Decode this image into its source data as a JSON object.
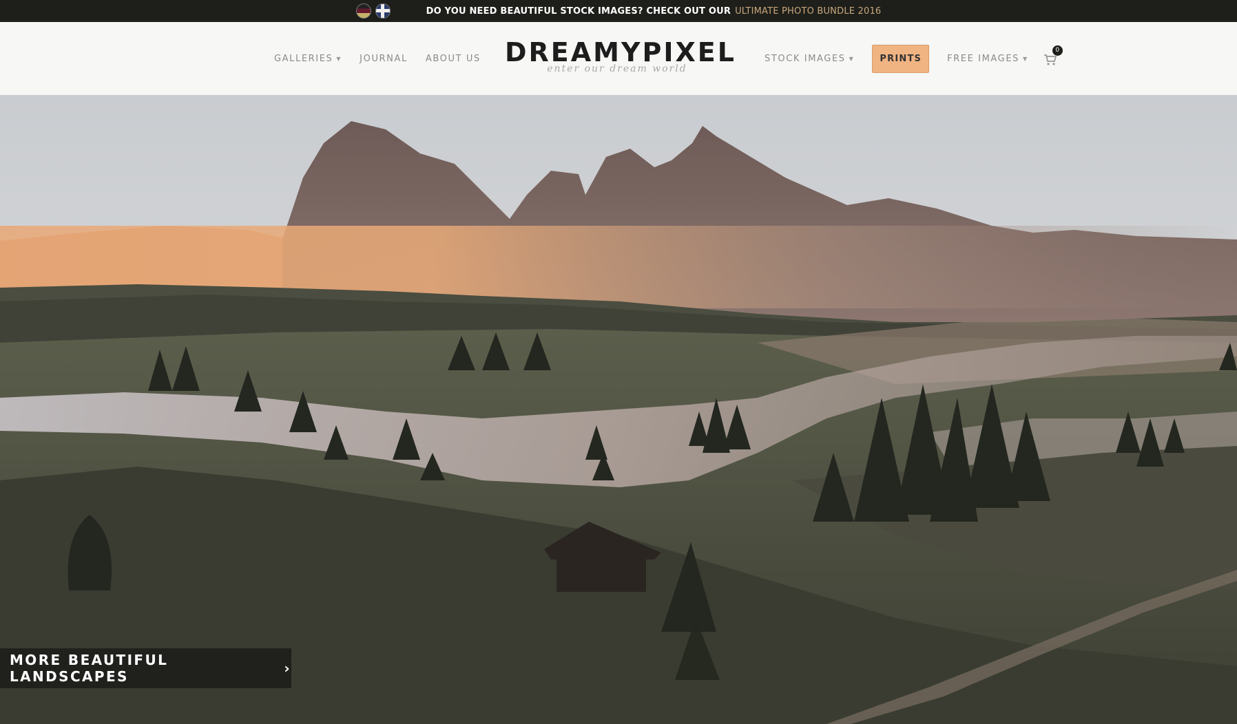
{
  "topbar": {
    "flags": [
      "german-flag-icon",
      "uk-flag-icon"
    ],
    "promo_text": "DO YOU NEED BEAUTIFUL STOCK IMAGES? CHECK OUT OUR",
    "promo_link": "ULTIMATE PHOTO BUNDLE 2016"
  },
  "header": {
    "nav_left": [
      {
        "label": "GALLERIES",
        "dropdown": true
      },
      {
        "label": "JOURNAL",
        "dropdown": false
      },
      {
        "label": "ABOUT US",
        "dropdown": false
      }
    ],
    "logo": {
      "title": "DREAMYPIXEL",
      "tagline": "enter our dream world"
    },
    "nav_right": [
      {
        "label": "STOCK IMAGES",
        "dropdown": true
      },
      {
        "label": "FREE IMAGES",
        "dropdown": true
      }
    ],
    "prints_label": "PRINTS",
    "cart_count": "0"
  },
  "hero": {
    "cta_label": "MORE BEAUTIFUL LANDSCAPES",
    "cta_arrow": "›"
  },
  "colors": {
    "topbar_bg": "#1e1f1a",
    "accent": "#f0b382",
    "promo_link": "#c9a77d"
  }
}
